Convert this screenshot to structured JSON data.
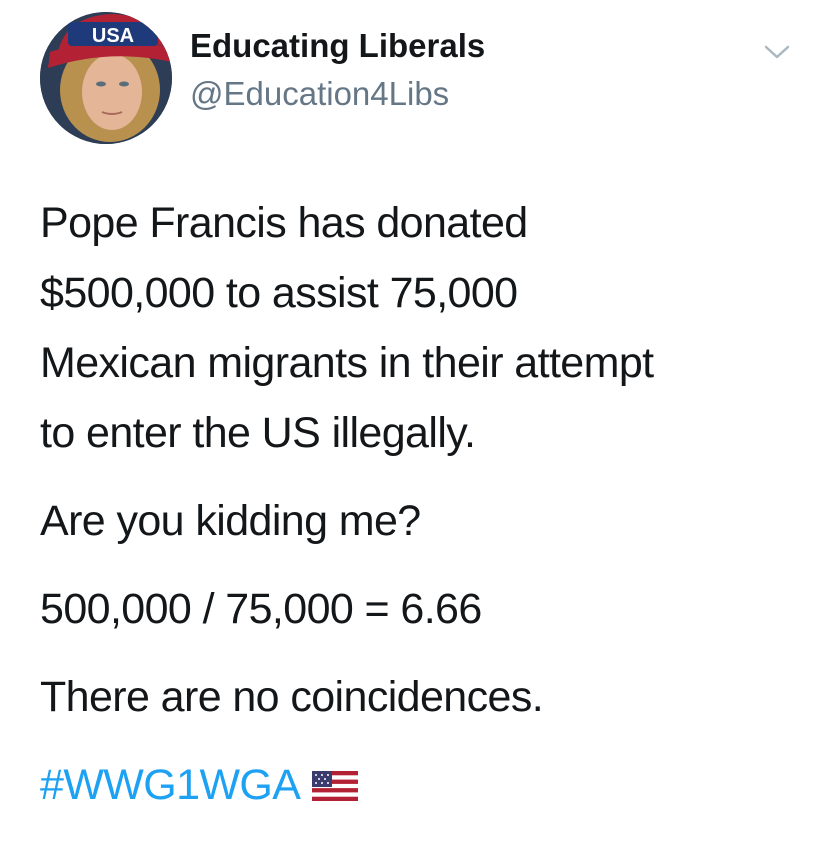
{
  "user": {
    "display_name": "Educating Liberals",
    "handle": "@Education4Libs",
    "avatar_hat_text": "USA"
  },
  "tweet": {
    "line1": "Pope Francis has donated",
    "line2": "$500,000 to assist 75,000",
    "line3": "Mexican migrants in their attempt",
    "line4": "to enter the US illegally.",
    "para2": "Are you kidding me?",
    "para3": "500,000 / 75,000 = 6.66",
    "para4": "There are no coincidences.",
    "hashtag": "#WWG1WGA",
    "emoji": "us-flag-emoji"
  },
  "colors": {
    "text": "#14171a",
    "secondary": "#657786",
    "link": "#1da1f2"
  },
  "icons": {
    "menu": "chevron-down-icon"
  }
}
